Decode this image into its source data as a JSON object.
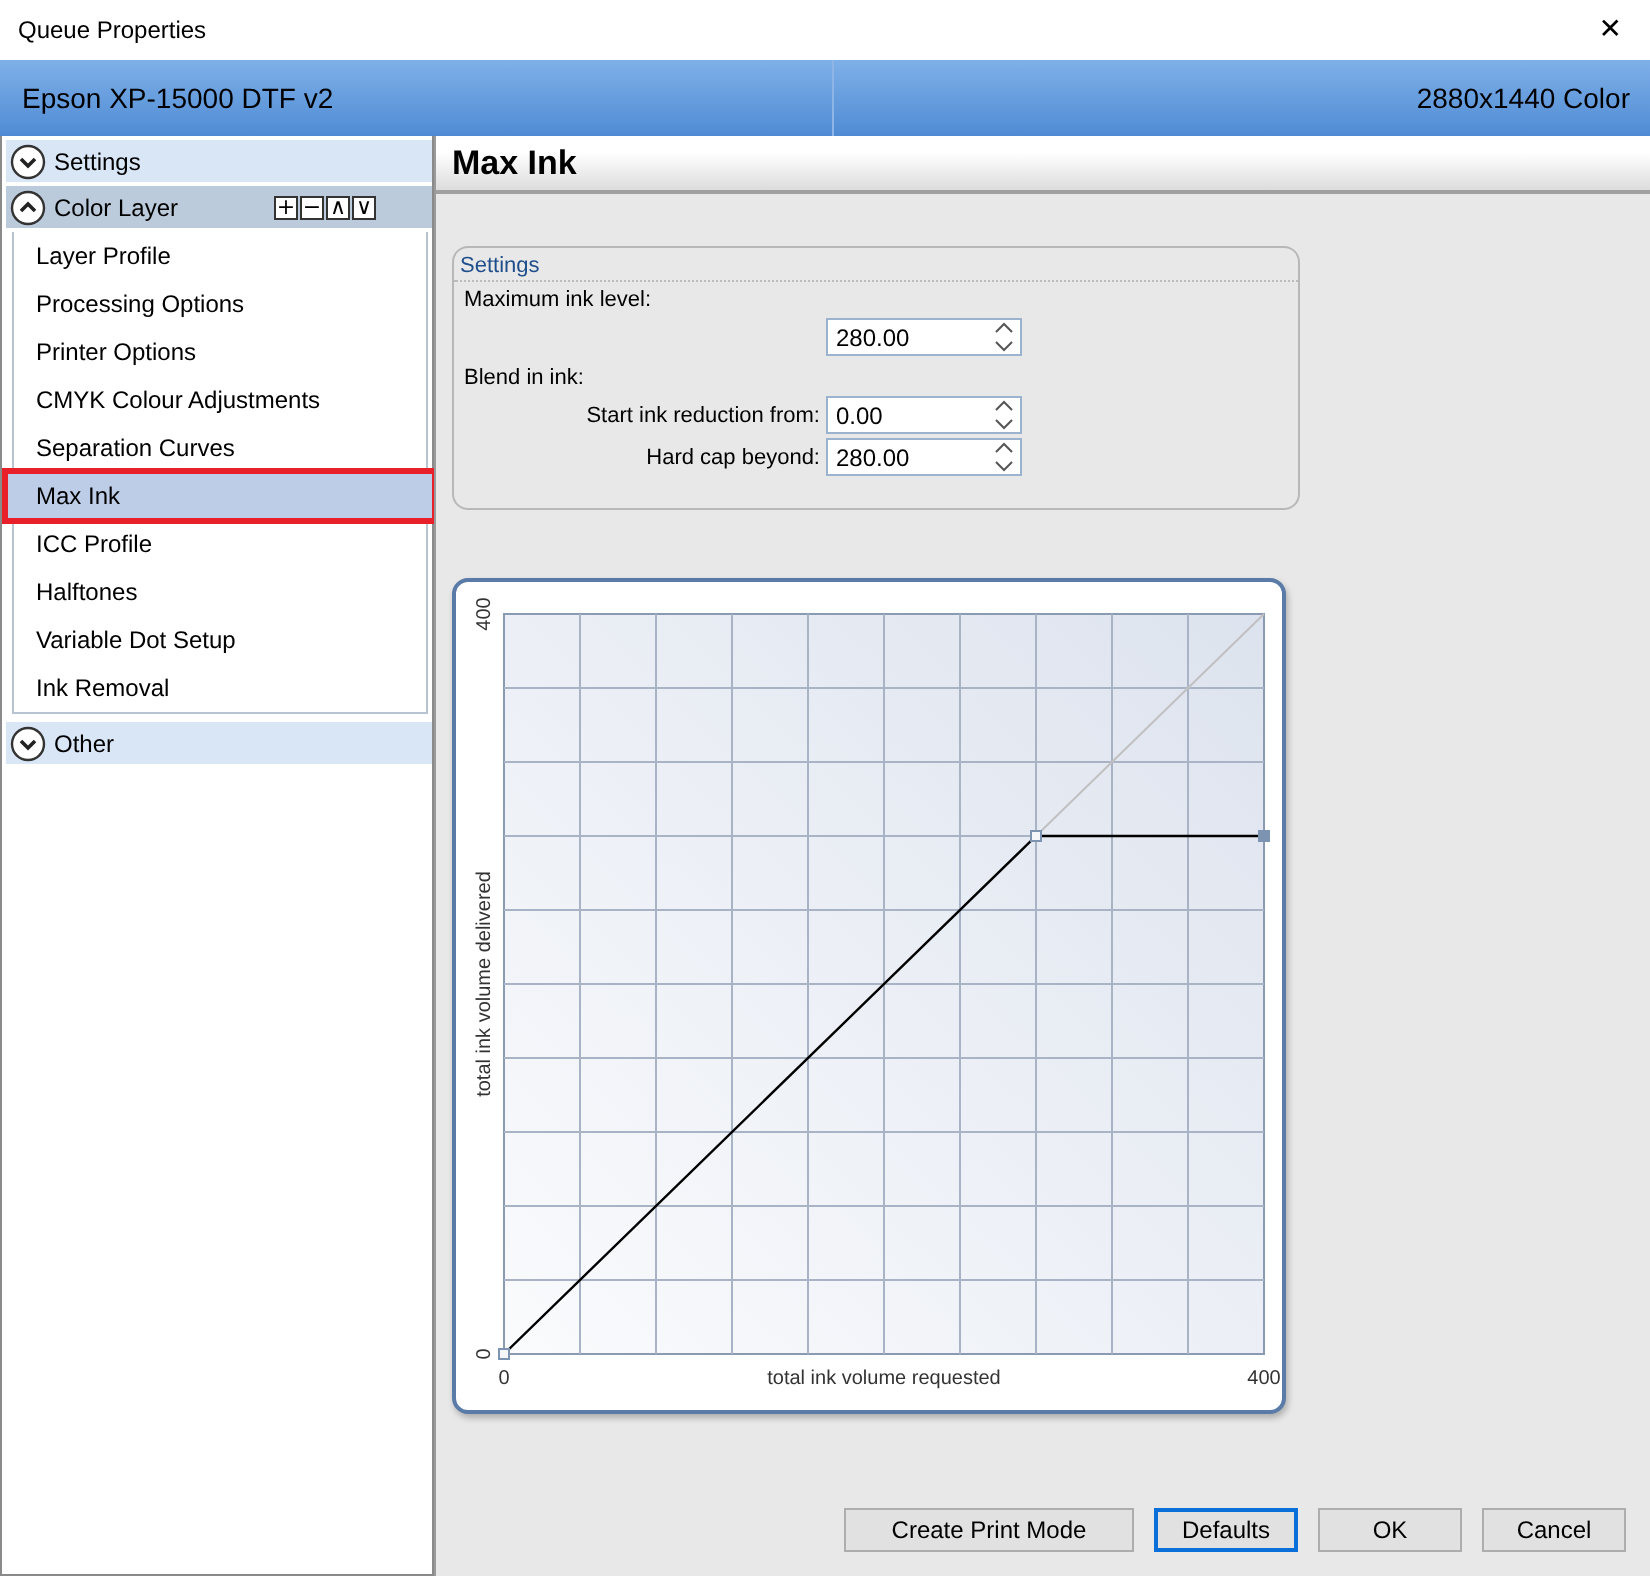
{
  "window": {
    "title": "Queue Properties",
    "close": "✕"
  },
  "header": {
    "printer": "Epson XP-15000 DTF v2",
    "mode": "2880x1440 Color"
  },
  "sidebar": {
    "sections": [
      {
        "label": "Settings",
        "expanded": false
      },
      {
        "label": "Color Layer",
        "expanded": true,
        "tools": [
          "+",
          "−",
          "∧",
          "∨"
        ],
        "items": [
          {
            "label": "Layer Profile",
            "selected": false,
            "highlighted": false
          },
          {
            "label": "Processing Options",
            "selected": false,
            "highlighted": false
          },
          {
            "label": "Printer Options",
            "selected": false,
            "highlighted": false
          },
          {
            "label": "CMYK Colour Adjustments",
            "selected": false,
            "highlighted": false
          },
          {
            "label": "Separation Curves",
            "selected": false,
            "highlighted": false
          },
          {
            "label": "Max Ink",
            "selected": true,
            "highlighted": true
          },
          {
            "label": "ICC Profile",
            "selected": false,
            "highlighted": false
          },
          {
            "label": "Halftones",
            "selected": false,
            "highlighted": false
          },
          {
            "label": "Variable Dot Setup",
            "selected": false,
            "highlighted": false
          },
          {
            "label": "Ink Removal",
            "selected": false,
            "highlighted": false
          }
        ]
      },
      {
        "label": "Other",
        "expanded": false
      }
    ]
  },
  "panel": {
    "title": "Max Ink",
    "settings": {
      "title": "Settings",
      "max_label": "Maximum ink level:",
      "max_value": "280.00",
      "blend_label": "Blend in ink:",
      "fields": [
        {
          "label": "Start ink reduction from:",
          "value": "0.00"
        },
        {
          "label": "Hard cap beyond:",
          "value": "280.00"
        }
      ]
    },
    "chart": {
      "chart_data": {
        "type": "line",
        "xlabel": "total ink volume requested",
        "ylabel": "total ink volume delivered",
        "x": [
          0,
          280,
          400
        ],
        "series": [
          {
            "color": "#000000",
            "values": [
              0,
              280,
              280
            ],
            "marker": "square"
          },
          {
            "color": "#c0c0c0",
            "values": [
              null,
              280,
              400
            ]
          }
        ],
        "xlim": [
          0,
          400
        ],
        "ylim": [
          0,
          400
        ],
        "xticks": [
          0,
          400
        ],
        "yticks": [
          0,
          400
        ]
      }
    }
  },
  "buttons": [
    {
      "label": "Create Print Mode",
      "selected": false
    },
    {
      "label": "Defaults",
      "selected": true
    },
    {
      "label": "OK",
      "selected": false
    },
    {
      "label": "Cancel",
      "selected": false
    }
  ]
}
